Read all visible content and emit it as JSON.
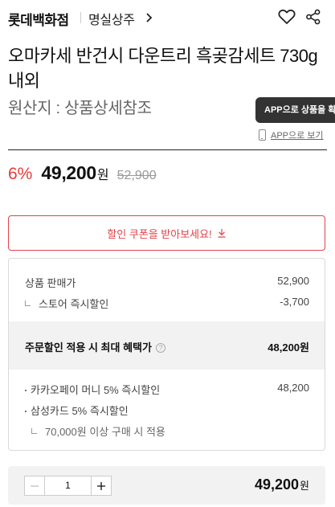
{
  "header": {
    "brand": "롯데백화점",
    "shop": "명실상주"
  },
  "product": {
    "title": "오마카세 반건시 다운트리 흑곶감세트 730g내외",
    "origin": "원산지 : 상품상세참조"
  },
  "app": {
    "tooltip": "APP으로 상품을 확",
    "link": "APP으로 보기"
  },
  "price": {
    "discount_rate": "6%",
    "sale_price": "49,200",
    "currency": "원",
    "original_price": "52,900"
  },
  "coupon": {
    "label": "할인 쿠폰을 받아보세요!"
  },
  "breakdown": {
    "list_price_label": "상품 판매가",
    "list_price_value": "52,900",
    "store_discount_label": "스토어 즉시할인",
    "store_discount_value": "-3,700",
    "max_benefit_label": "주문할인 적용 시 최대 혜택가",
    "max_benefit_value": "48,200원",
    "kakaopay_label": "카카오페이 머니 5% 즉시할인",
    "kakaopay_value": "48,200",
    "samsung_label": "삼성카드 5% 즉시할인",
    "samsung_note": "70,000원 이상 구매 시 적용"
  },
  "order": {
    "quantity": "1",
    "total": "49,200",
    "total_unit": "원"
  },
  "colors": {
    "accent_red": "#e2424b",
    "discount_red": "#e63a3a"
  }
}
